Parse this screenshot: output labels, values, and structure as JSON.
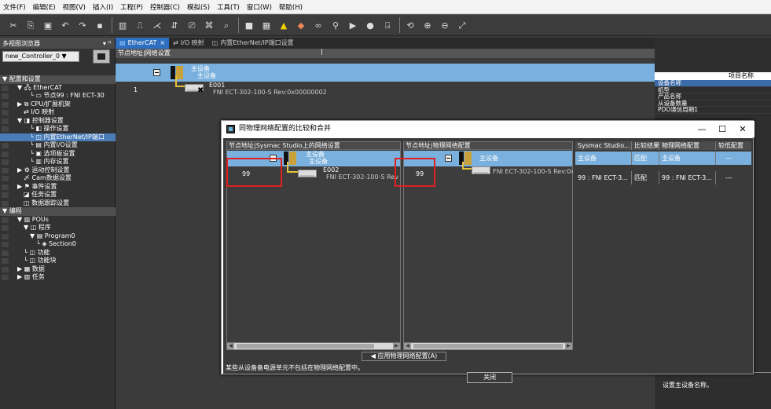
{
  "menu": [
    "文件(F)",
    "编辑(E)",
    "视图(V)",
    "插入(I)",
    "工程(P)",
    "控制器(C)",
    "模拟(S)",
    "工具(T)",
    "窗口(W)",
    "帮助(H)"
  ],
  "toolbar_icons": [
    "cut-icon",
    "copy-icon",
    "paste-icon",
    "undo-icon",
    "redo-icon",
    "save-icon",
    "build-icon",
    "online-icon",
    "offline-icon",
    "transfer-icon",
    "compare-icon",
    "monitor-icon",
    "find-icon",
    "stop-icon",
    "simulate-icon",
    "warning-icon",
    "error-icon",
    "link-icon",
    "unlink-icon",
    "run-icon",
    "pause-icon",
    "step-icon",
    "reset-icon",
    "zoom-in-icon",
    "zoom-out-icon",
    "zoom-fit-icon"
  ],
  "left_panel": {
    "title": "多视图浏览器",
    "pin": "▾ ꟸ",
    "controller": "new_Controller_0 ▼",
    "tree": [
      {
        "label": "▼ 配置和设置",
        "indent": 0,
        "style": "hdr"
      },
      {
        "label": "▼ 🖧 EtherCAT",
        "indent": 1
      },
      {
        "label": "└ ▭ 节点99 : FNI ECT-30",
        "indent": 3
      },
      {
        "label": "▶ ⧉ CPU/扩展机架",
        "indent": 1
      },
      {
        "label": "⇄ I/O 映射",
        "indent": 2
      },
      {
        "label": "▼ ◨ 控制器设置",
        "indent": 1
      },
      {
        "label": "└ ◧ 操作设置",
        "indent": 3
      },
      {
        "label": "└ ◫ 内置EtherNet/IP端口",
        "indent": 3,
        "style": "sel"
      },
      {
        "label": "└ ▤ 内置I/O设置",
        "indent": 3
      },
      {
        "label": "└ ▣ 选项板设置",
        "indent": 3
      },
      {
        "label": "└ ▥ 内存设置",
        "indent": 3
      },
      {
        "label": "▶ ⚙ 运动控制设置",
        "indent": 1
      },
      {
        "label": "〆 Cam数据设置",
        "indent": 2
      },
      {
        "label": "▶ ⚑ 事件设置",
        "indent": 1
      },
      {
        "label": "◪ 任务设置",
        "indent": 2
      },
      {
        "label": "◫ 数据跟踪设置",
        "indent": 2
      },
      {
        "label": "▼ 编程",
        "indent": 0,
        "style": "hdr"
      },
      {
        "label": "▼ ▥ POUs",
        "indent": 1
      },
      {
        "label": "▼ ◫ 程序",
        "indent": 2
      },
      {
        "label": "▼ ▤ Program0",
        "indent": 3
      },
      {
        "label": "└ ◈ Section0",
        "indent": 4
      },
      {
        "label": "└ ◫ 功能",
        "indent": 2
      },
      {
        "label": "└ ◫ 功能块",
        "indent": 2
      },
      {
        "label": "▶ ▦ 数据",
        "indent": 1
      },
      {
        "label": "▶ ▥ 任务",
        "indent": 1
      }
    ]
  },
  "tabs": [
    {
      "label": "EtherCAT",
      "close": "×",
      "active": true
    },
    {
      "label": "I/O 映射",
      "active": false
    },
    {
      "label": "内置EtherNet/IP端口设置",
      "active": false
    }
  ],
  "network_view": {
    "header": "节点地址|网络设置",
    "master_label": "主设备",
    "master_sublabel": "主设备",
    "slave_num": "1",
    "slave_name": "E001",
    "slave_model": "FNI ECT-302-100-S Rev:0x00000002"
  },
  "right_panel": {
    "header": "项目名称",
    "props": [
      "设备名称",
      "机型",
      "产品名称",
      "从设备数量",
      "PDO通信周期1"
    ],
    "description": "设置主设备名称。"
  },
  "dialog": {
    "title": "同物理网络配置的比较和合并",
    "minimize": "—",
    "maximize": "☐",
    "close": "✕",
    "left_pane": {
      "header": "节点地址|Sysmac Studio上的网络设置",
      "master_label": "主设备",
      "master_sublabel": "主设备",
      "slave_num": "99",
      "slave_name": "E002",
      "slave_model": "FNI ECT-302-100-S Rev"
    },
    "mid_pane": {
      "header": "节点地址|物理网络配置",
      "master_label": "主设备",
      "slave_num": "99",
      "slave_model": "FNI ECT-302-100-S Rev:0x0"
    },
    "table": {
      "headers": [
        "Sysmac Studio...",
        "比较结果",
        "物理网络配置",
        "较低配置"
      ],
      "rows": [
        [
          "主设备",
          "匹配",
          "主设备",
          "---"
        ],
        [
          "99 : FNI ECT-3...",
          "匹配",
          "99 : FNI ECT-3...",
          "---"
        ]
      ]
    },
    "apply_label": "◀ 应用物理网络配置(A)",
    "note": "某些从设备备电源单元不包括在物理网络配置中。",
    "close_label": "关闭"
  },
  "colors": {
    "accent_tab": "#2f6fc0",
    "selection": "#7ab0dd",
    "highlight_box": "#e02020"
  }
}
